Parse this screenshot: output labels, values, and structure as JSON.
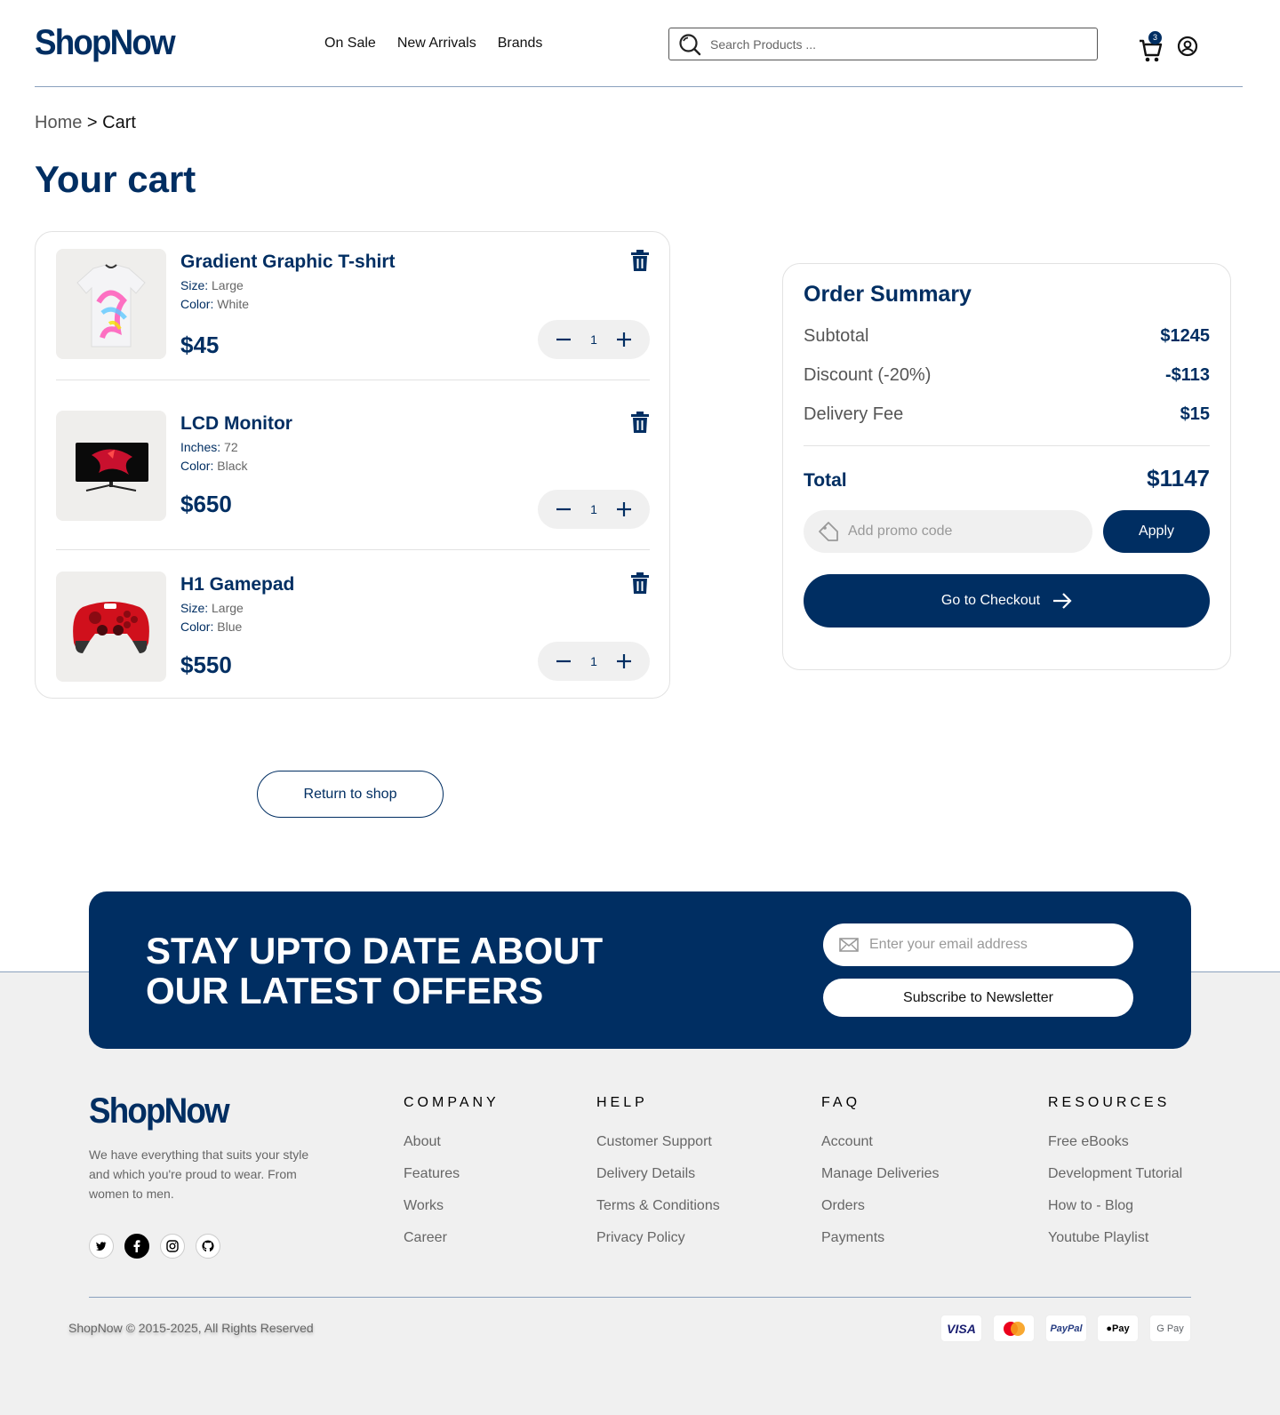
{
  "header": {
    "logo": "ShopNow",
    "nav": [
      "On Sale",
      "New Arrivals",
      "Brands"
    ],
    "search_placeholder": "Search Products ...",
    "cart_count": "3"
  },
  "breadcrumb": {
    "home": "Home",
    "separator": ">",
    "current": "Cart"
  },
  "page_title": "Your cart",
  "cart_items": [
    {
      "name": "Gradient Graphic T-shirt",
      "attr1_key": "Size:",
      "attr1_val": "Large",
      "attr2_key": "Color:",
      "attr2_val": "White",
      "price": "$45",
      "qty": "1"
    },
    {
      "name": "LCD Monitor",
      "attr1_key": "Inches:",
      "attr1_val": "72",
      "attr2_key": "Color:",
      "attr2_val": "Black",
      "price": "$650",
      "qty": "1"
    },
    {
      "name": "H1 Gamepad",
      "attr1_key": "Size:",
      "attr1_val": "Large",
      "attr2_key": "Color:",
      "attr2_val": "Blue",
      "price": "$550",
      "qty": "1"
    }
  ],
  "summary": {
    "title": "Order Summary",
    "subtotal_label": "Subtotal",
    "subtotal": "$1245",
    "discount_label": "Discount (-20%)",
    "discount": "-$113",
    "delivery_label": "Delivery Fee",
    "delivery": "$15",
    "total_label": "Total",
    "total": "$1147",
    "promo_placeholder": "Add promo code",
    "apply_label": "Apply",
    "checkout_label": "Go to Checkout"
  },
  "return_label": "Return to shop",
  "newsletter": {
    "title_line1": "STAY UPTO DATE ABOUT",
    "title_line2": "OUR LATEST OFFERS",
    "email_placeholder": "Enter your email address",
    "button_label": "Subscribe to Newsletter"
  },
  "footer": {
    "logo": "ShopNow",
    "description": "We have everything that suits your style and which you're proud to wear. From women to men.",
    "columns": [
      {
        "title": "COMPANY",
        "links": [
          "About",
          "Features",
          "Works",
          "Career"
        ]
      },
      {
        "title": "HELP",
        "links": [
          "Customer Support",
          "Delivery Details",
          "Terms & Conditions",
          "Privacy Policy"
        ]
      },
      {
        "title": "FAQ",
        "links": [
          "Account",
          "Manage Deliveries",
          "Orders",
          "Payments"
        ]
      },
      {
        "title": "RESOURCES",
        "links": [
          "Free eBooks",
          "Development Tutorial",
          "How to - Blog",
          "Youtube Playlist"
        ]
      }
    ],
    "copyright": "ShopNow © 2015-2025, All Rights Reserved",
    "payments": [
      "VISA",
      "",
      "PayPal",
      "Pay",
      "G Pay"
    ]
  },
  "colors": {
    "brand": "#002e62",
    "muted_bg": "#f0f0f0"
  }
}
